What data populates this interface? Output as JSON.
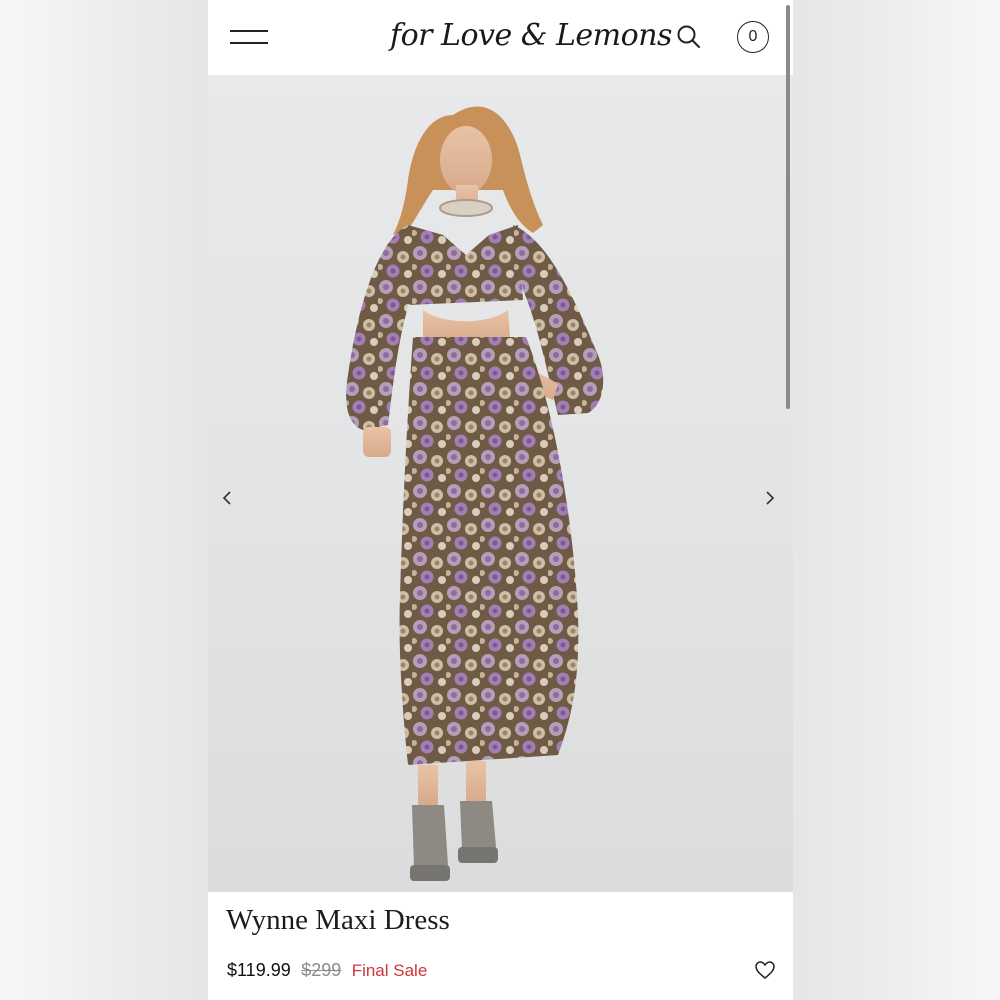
{
  "header": {
    "logo_text": "for Love & Lemons",
    "menu_icon": "hamburger-menu-icon",
    "search_icon": "search-icon",
    "cart_count": "0"
  },
  "gallery": {
    "image_alt": "Model wearing floral maxi dress",
    "prev_icon": "chevron-left-icon",
    "next_icon": "chevron-right-icon"
  },
  "product": {
    "title": "Wynne Maxi Dress",
    "price": "$119.99",
    "compare_price": "$299",
    "sale_label": "Final Sale",
    "wishlist_icon": "heart-icon"
  },
  "colors": {
    "sale": "#d1353c",
    "strike_price": "#8b8b8b"
  }
}
